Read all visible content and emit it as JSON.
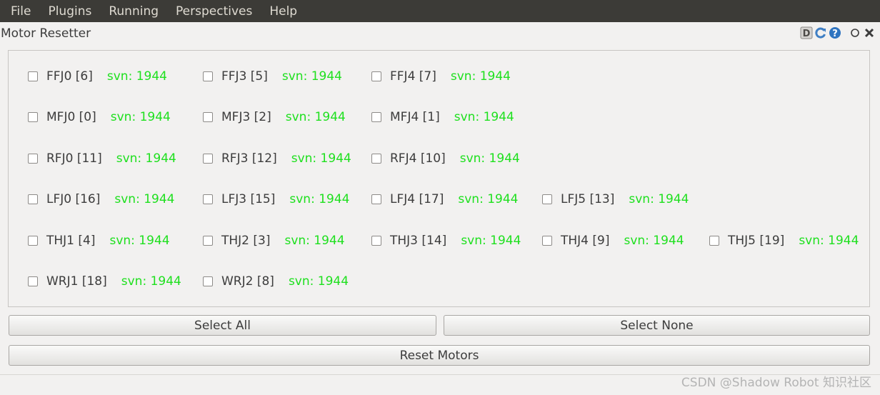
{
  "menubar": {
    "items": [
      {
        "label": "File"
      },
      {
        "label": "Plugins"
      },
      {
        "label": "Running"
      },
      {
        "label": "Perspectives"
      },
      {
        "label": "Help"
      }
    ]
  },
  "window": {
    "title": "Motor Resetter",
    "title_icons": [
      "d-icon",
      "reload-icon",
      "help-icon",
      "circle-icon",
      "close-icon"
    ]
  },
  "motors": [
    {
      "label": "FFJ0 [6]",
      "svn": "svn: 1944",
      "checked": false
    },
    {
      "label": "FFJ3 [5]",
      "svn": "svn: 1944",
      "checked": false
    },
    {
      "label": "FFJ4 [7]",
      "svn": "svn: 1944",
      "checked": false
    },
    {
      "label": "MFJ0 [0]",
      "svn": "svn: 1944",
      "checked": false
    },
    {
      "label": "MFJ3 [2]",
      "svn": "svn: 1944",
      "checked": false
    },
    {
      "label": "MFJ4 [1]",
      "svn": "svn: 1944",
      "checked": false
    },
    {
      "label": "RFJ0 [11]",
      "svn": "svn: 1944",
      "checked": false
    },
    {
      "label": "RFJ3 [12]",
      "svn": "svn: 1944",
      "checked": false
    },
    {
      "label": "RFJ4 [10]",
      "svn": "svn: 1944",
      "checked": false
    },
    {
      "label": "LFJ0 [16]",
      "svn": "svn: 1944",
      "checked": false
    },
    {
      "label": "LFJ3 [15]",
      "svn": "svn: 1944",
      "checked": false
    },
    {
      "label": "LFJ4 [17]",
      "svn": "svn: 1944",
      "checked": false
    },
    {
      "label": "LFJ5 [13]",
      "svn": "svn: 1944",
      "checked": false
    },
    {
      "label": "THJ1 [4]",
      "svn": "svn: 1944",
      "checked": false
    },
    {
      "label": "THJ2 [3]",
      "svn": "svn: 1944",
      "checked": false
    },
    {
      "label": "THJ3 [14]",
      "svn": "svn: 1944",
      "checked": false
    },
    {
      "label": "THJ4 [9]",
      "svn": "svn: 1944",
      "checked": false
    },
    {
      "label": "THJ5 [19]",
      "svn": "svn: 1944",
      "checked": false
    },
    {
      "label": "WRJ1 [18]",
      "svn": "svn: 1944",
      "checked": false
    },
    {
      "label": "WRJ2 [8]",
      "svn": "svn: 1944",
      "checked": false
    }
  ],
  "buttons": {
    "select_all": "Select All",
    "select_none": "Select None",
    "reset_motors": "Reset Motors"
  },
  "watermark": "CSDN @Shadow Robot 知识社区",
  "colors": {
    "menubar_bg": "#3c3b37",
    "svn_green": "#1ee01e",
    "background": "#f2f1f0"
  }
}
